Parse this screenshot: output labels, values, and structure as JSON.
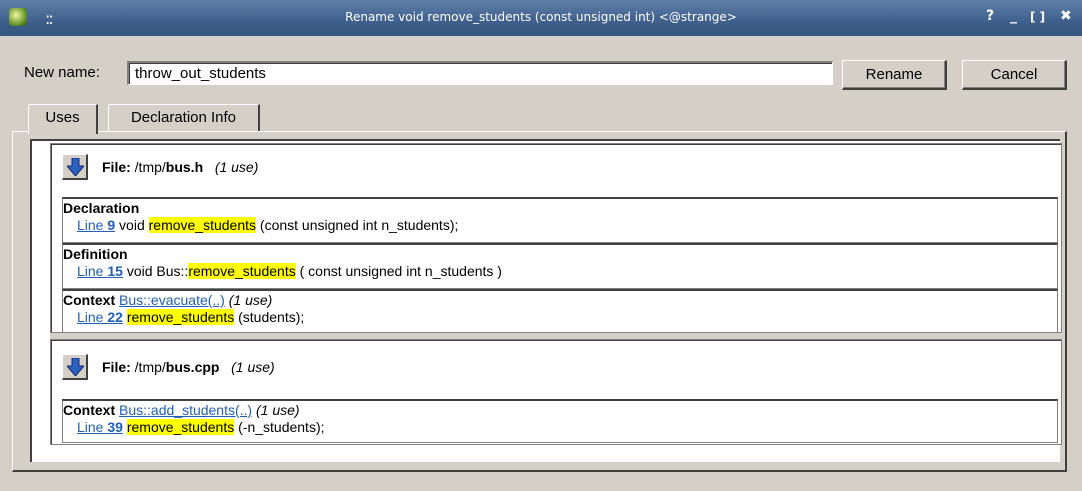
{
  "window": {
    "title": "Rename void remove_students (const unsigned int) <@strange>",
    "help": "?",
    "minimize": "_",
    "maximize": "[ ]",
    "close": "✖",
    "grip": "::"
  },
  "form": {
    "new_name_label": "New name:",
    "new_name_value": "throw_out_students",
    "rename_button": "Rename",
    "cancel_button": "Cancel"
  },
  "tabs": [
    {
      "label": "Uses",
      "active": true
    },
    {
      "label": "Declaration Info",
      "active": false
    }
  ],
  "files": [
    {
      "file_label": "File:",
      "path": "/tmp/",
      "filename": "bus.h",
      "uses": "(1 use)",
      "sections": [
        {
          "kind": "Declaration",
          "line_label": "Line",
          "line_no": "9",
          "prefix": "void ",
          "symbol": "remove_students",
          "suffix": " (const unsigned int n_students);"
        },
        {
          "kind": "Definition",
          "line_label": "Line",
          "line_no": "15",
          "prefix": "void Bus::",
          "symbol": "remove_students",
          "suffix": " ( const unsigned int n_students )"
        },
        {
          "kind": "Context",
          "context_link": "Bus::evacuate(..)",
          "context_uses": "(1 use)",
          "line_label": "Line",
          "line_no": "22",
          "prefix": "",
          "symbol": "remove_students",
          "suffix": " (students);"
        }
      ]
    },
    {
      "file_label": "File:",
      "path": "/tmp/",
      "filename": "bus.cpp",
      "uses": "(1 use)",
      "sections": [
        {
          "kind": "Context",
          "context_link": "Bus::add_students(..)",
          "context_uses": "(1 use)",
          "line_label": "Line",
          "line_no": "39",
          "prefix": "",
          "symbol": "remove_students",
          "suffix": " (-n_students);"
        }
      ]
    }
  ],
  "colors": {
    "highlight": "#ffff00",
    "link": "#1f5fb4",
    "titlebar": "#3f5f8c"
  }
}
